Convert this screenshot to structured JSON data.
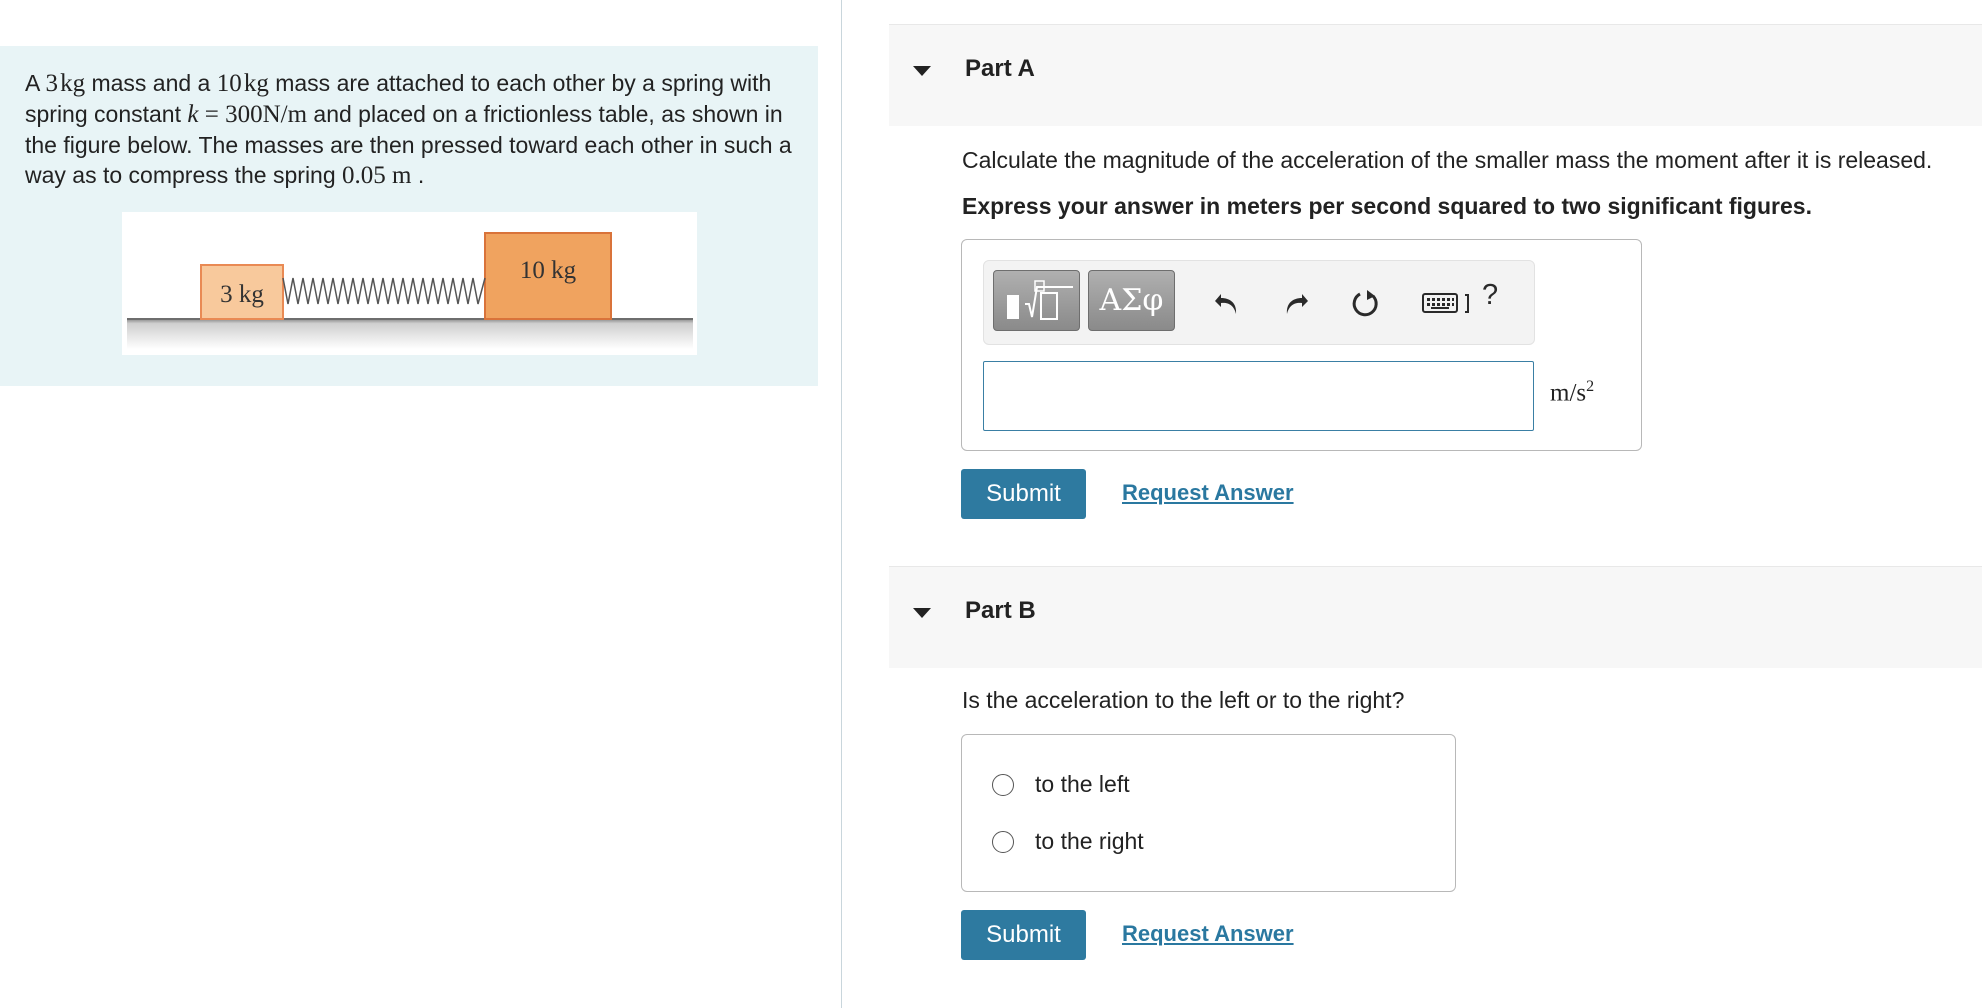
{
  "problem": {
    "seg1": "A ",
    "m1_num": "3",
    "m1_unit": "kg",
    "seg2": " mass and a ",
    "m2_num": "10",
    "m2_unit": "kg",
    "seg3": " mass are attached to each other by a spring with spring constant ",
    "k_var": "k",
    "k_eq": " = 300N/m",
    "seg4": " and placed on a frictionless table, as shown in the figure below. The masses are then pressed toward each other in such a way as to compress the spring ",
    "compress": "0.05 m",
    "seg5": " ."
  },
  "figure": {
    "small_mass_label": "3 kg",
    "large_mass_label": "10 kg"
  },
  "partA": {
    "title": "Part A",
    "question": "Calculate the magnitude of the acceleration of the smaller mass the moment after it is released.",
    "instruction": "Express your answer in meters per second squared to two significant figures.",
    "toolbar": {
      "symbols_label": "ΑΣφ",
      "help_label": "?"
    },
    "input_value": "",
    "units_base": "m/s",
    "units_exp": "2",
    "submit_label": "Submit",
    "request_label": "Request Answer"
  },
  "partB": {
    "title": "Part B",
    "question": "Is the acceleration to the left or to the right?",
    "options": [
      "to the left",
      "to the right"
    ],
    "submit_label": "Submit",
    "request_label": "Request Answer"
  },
  "colors": {
    "accent": "#2e7aa0",
    "problem_bg": "#e8f4f6",
    "mass_small": "#f8c99c",
    "mass_large": "#f0a35f"
  }
}
